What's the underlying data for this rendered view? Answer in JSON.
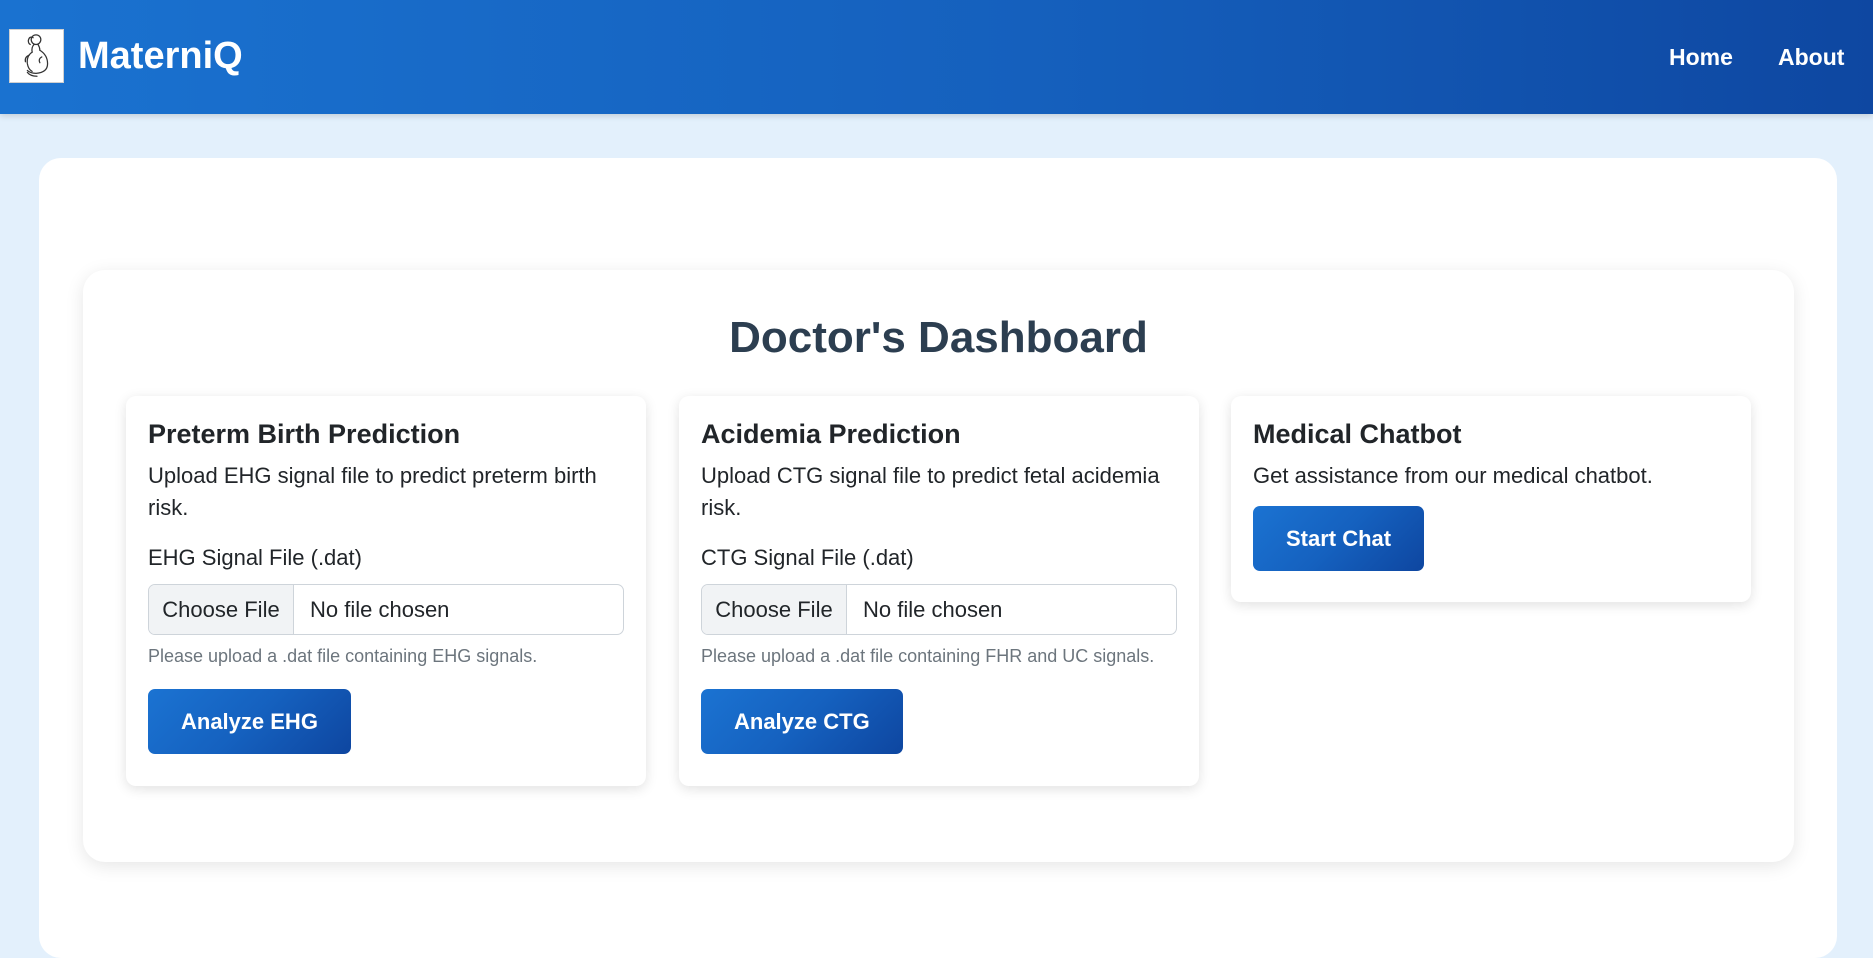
{
  "navbar": {
    "brand": "MaterniQ",
    "links": {
      "home": "Home",
      "about": "About"
    }
  },
  "dashboard": {
    "title": "Doctor's Dashboard"
  },
  "cards": {
    "preterm": {
      "title": "Preterm Birth Prediction",
      "description": "Upload EHG signal file to predict preterm birth risk.",
      "field_label": "EHG Signal File (.dat)",
      "file_button": "Choose File",
      "file_status": "No file chosen",
      "help": "Please upload a .dat file containing EHG signals.",
      "submit": "Analyze EHG"
    },
    "acidemia": {
      "title": "Acidemia Prediction",
      "description": "Upload CTG signal file to predict fetal acidemia risk.",
      "field_label": "CTG Signal File (.dat)",
      "file_button": "Choose File",
      "file_status": "No file chosen",
      "help": "Please upload a .dat file containing FHR and UC signals.",
      "submit": "Analyze CTG"
    },
    "chatbot": {
      "title": "Medical Chatbot",
      "description": "Get assistance from our medical chatbot.",
      "submit": "Start Chat"
    }
  },
  "colors": {
    "navbar_start": "#1a72d0",
    "navbar_end": "#0e47a1",
    "page_background": "#e3f0fc",
    "title_color": "#2c3e50",
    "button_start": "#1b73d2",
    "button_end": "#0e46a0"
  },
  "icons": {
    "logo": "pregnant-woman-icon"
  }
}
